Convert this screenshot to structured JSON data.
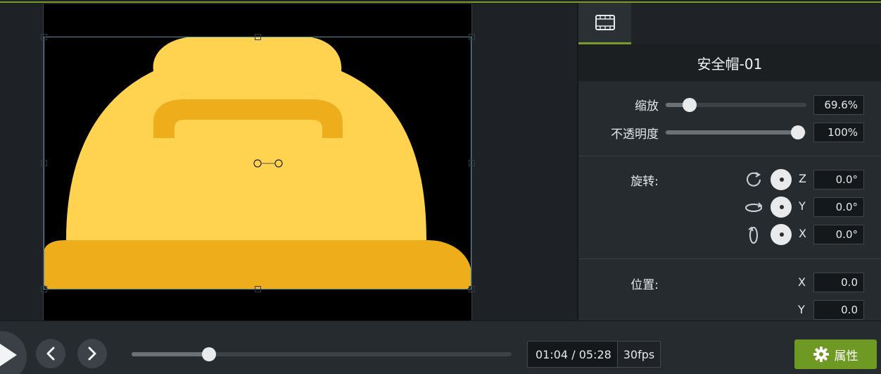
{
  "panel": {
    "title": "安全帽-01",
    "scale": {
      "label": "缩放",
      "value": "69.6%",
      "fraction": 0.17
    },
    "opacity": {
      "label": "不透明度",
      "value": "100%",
      "fraction": 1.0
    },
    "rotation": {
      "label": "旋转:",
      "z": {
        "axis": "Z",
        "value": "0.0°"
      },
      "y": {
        "axis": "Y",
        "value": "0.0°"
      },
      "x": {
        "axis": "X",
        "value": "0.0°"
      }
    },
    "position": {
      "label": "位置:",
      "x": {
        "axis": "X",
        "value": "0.0"
      },
      "y": {
        "axis": "Y",
        "value": "0.0"
      }
    }
  },
  "playback": {
    "current_time": "01:04",
    "total_time": "05:28",
    "separator": "/",
    "fps": "30fps",
    "progress": 0.2
  },
  "properties_button": {
    "label": "属性"
  },
  "colors": {
    "accent": "#7a9a2c",
    "hat_main": "#ffd24f",
    "hat_brim": "#eeae1c",
    "properties_button": "#6e9a24"
  }
}
